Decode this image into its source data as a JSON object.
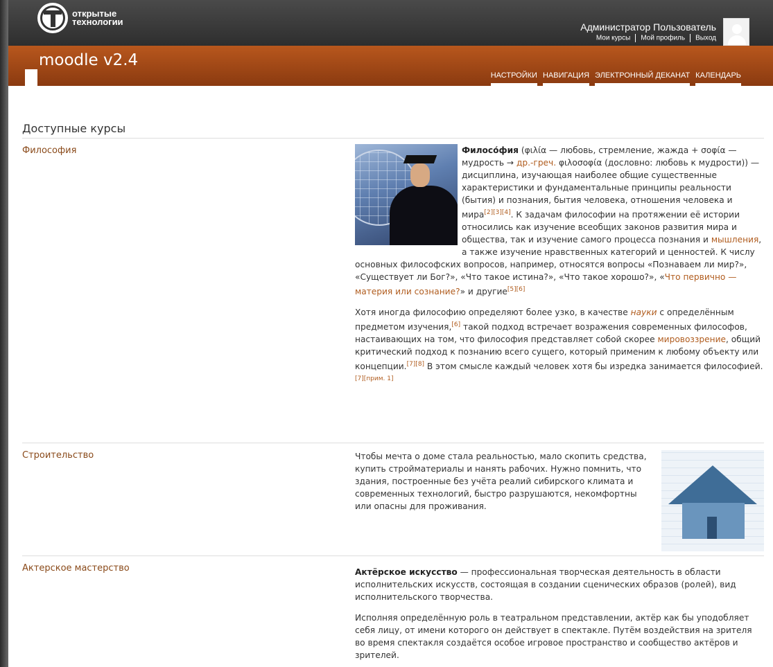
{
  "header": {
    "logo_line1": "открытые",
    "logo_line2": "технологии",
    "user_name": "Администратор Пользователь",
    "user_links": [
      "Мои курсы",
      "Мой профиль",
      "Выход"
    ],
    "site_title": "moodle v2.4"
  },
  "nav": {
    "items": [
      "НАСТРОЙКИ",
      "НАВИГАЦИЯ",
      "ЭЛЕКТРОННЫЙ ДЕКАНАТ",
      "КАЛЕНДАРЬ"
    ]
  },
  "main": {
    "heading": "Доступные курсы",
    "courses": [
      {
        "name": "Философия",
        "image_icon": "graduate-photo",
        "p1_term": "Филосо́фия",
        "p1_a": " (φιλία — любовь, стремление, жажда + σοφία — мудрость → ",
        "p1_link1": "др.-греч.",
        "p1_b": " φιλοσοφία (дословно: любовь к мудрости)) — дисциплина, изучающая наиболее общие существенные характеристики и фундаментальные принципы реальности (бытия) и познания, бытия человека, отношения человека и мира",
        "p1_refs1": "[2][3][4]",
        "p1_c": ". К задачам философии на протяжении её истории относились как изучение всеобщих законов развития мира и общества, так и изучение самого процесса познания и ",
        "p1_link2": "мышления",
        "p1_d": ", а также изучение нравственных категорий и ценностей. К числу основных философских вопросов, например, относятся вопросы «Познаваем ли мир?», «Существует ли Бог?», «Что такое истина?», «Что такое хорошо?», «",
        "p1_link3": "Что первично — материя или сознание?",
        "p1_e": "» и другие",
        "p1_refs2": "[5][6]",
        "p2_a": "Хотя иногда философию определяют более узко, в качестве ",
        "p2_link1": "науки",
        "p2_b": " с определённым предметом изучения,",
        "p2_refs1": "[6]",
        "p2_c": " такой подход встречает возражения современных философов, настаивающих на том, что философия представляет собой скорее ",
        "p2_link2": "мировоззрение",
        "p2_d": ", общий критический подход к познанию всего сущего, который применим к любому объекту или концепции.",
        "p2_refs2": "[7][8]",
        "p2_e": " В этом смысле каждый человек хотя бы изредка занимается философией.",
        "p2_refs3": "[7][прим. 1]"
      },
      {
        "name": "Строительство",
        "image_icon": "house-blueprint-photo",
        "p1": "Чтобы мечта о доме стала реальностью, мало скопить средства, купить стройматериалы и нанять рабочих. Нужно помнить, что здания, построенные без учёта реалий сибирского климата и современных технологий, быстро разрушаются, некомфортны или опасны для проживания."
      },
      {
        "name": "Актерское мастерство",
        "p1_term": "Актёрское искусство",
        "p1_rest": " — профессиональная творческая деятельность в области исполнительских искусств, состоящая в создании сценических образов (ролей), вид исполнительского творчества.",
        "p2": "Исполняя определённую роль в театральном представлении, актёр как бы уподобляет себя лицу, от имени которого он действует в спектакле. Путём воздействия на зрителя во время спектакля создаётся особое игровое пространство и сообщество актёров и зрителей."
      }
    ]
  }
}
